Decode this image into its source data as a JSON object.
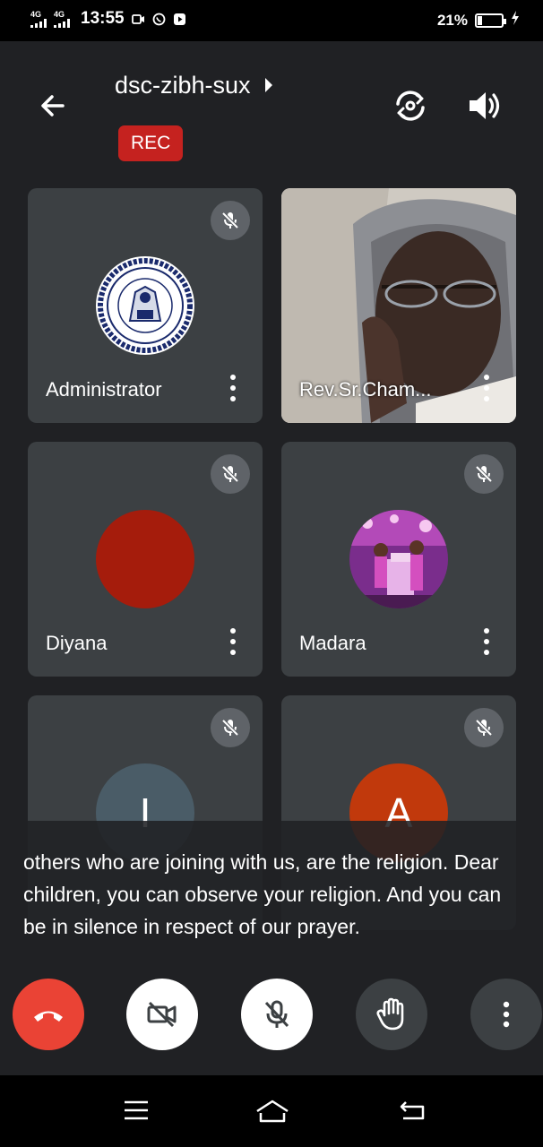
{
  "status_bar": {
    "signal1_label": "4G",
    "signal2_label": "4G",
    "time": "13:55",
    "battery_percent_text": "21%",
    "battery_level": 0.21,
    "icons": [
      "screen-record-icon",
      "whatsapp-icon",
      "youtube-icon",
      "charging-icon"
    ]
  },
  "header": {
    "meeting_code": "dsc-zibh-sux",
    "rec_label": "REC",
    "icons": [
      "back-arrow-icon",
      "chevron-right-icon",
      "switch-camera-icon",
      "speaker-icon"
    ]
  },
  "participants": [
    {
      "name": "Administrator",
      "muted": true,
      "avatar_type": "seal-logo"
    },
    {
      "name": "Rev.Sr.Cham...",
      "muted": false,
      "avatar_type": "video"
    },
    {
      "name": "Diyana",
      "muted": true,
      "avatar_type": "color",
      "avatar_color": "#a51c0c"
    },
    {
      "name": "Madara",
      "muted": true,
      "avatar_type": "photo"
    },
    {
      "name": "",
      "initial": "I",
      "muted": true,
      "avatar_type": "letter",
      "avatar_color": "#4a5c67"
    },
    {
      "name": "",
      "initial": "A",
      "muted": true,
      "avatar_type": "letter",
      "avatar_color": "#c1390c"
    }
  ],
  "captions": {
    "text": "others who are joining with us, are the religion. Dear children, you can observe your religion. And you can be in silence in respect of our prayer."
  },
  "controls": {
    "buttons": [
      "end-call-button",
      "camera-off-button",
      "mic-off-button",
      "raise-hand-button",
      "more-options-button"
    ],
    "colors": {
      "end_call": "#ea4335",
      "toggle_bg": "#ffffff",
      "neutral_bg": "#3c4043"
    }
  },
  "nav": {
    "buttons": [
      "recents-button",
      "home-button",
      "back-button"
    ]
  }
}
